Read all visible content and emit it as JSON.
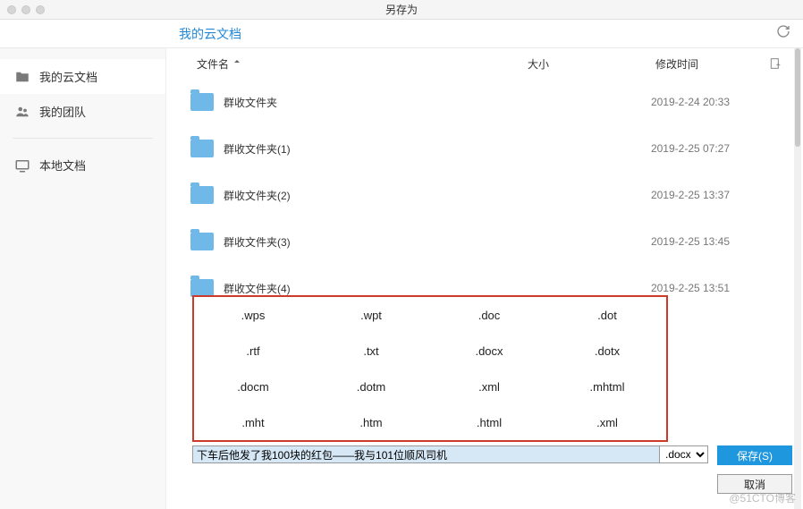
{
  "window": {
    "title": "另存为"
  },
  "toolbar": {
    "breadcrumb": "我的云文档"
  },
  "sidebar": {
    "items": [
      {
        "label": "我的云文档",
        "icon": "folder"
      },
      {
        "label": "我的团队",
        "icon": "team"
      },
      {
        "label": "本地文档",
        "icon": "device"
      }
    ]
  },
  "columns": {
    "name": "文件名",
    "size": "大小",
    "time": "修改时间"
  },
  "files": [
    {
      "name": "群收文件夹",
      "time": "2019-2-24 20:33"
    },
    {
      "name": "群收文件夹(1)",
      "time": "2019-2-25 07:27"
    },
    {
      "name": "群收文件夹(2)",
      "time": "2019-2-25 13:37"
    },
    {
      "name": "群收文件夹(3)",
      "time": "2019-2-25 13:45"
    },
    {
      "name": "群收文件夹(4)",
      "time": "2019-2-25 13:51"
    }
  ],
  "extensions": [
    ".wps",
    ".wpt",
    ".doc",
    ".dot",
    ".rtf",
    ".txt",
    ".docx",
    ".dotx",
    ".docm",
    ".dotm",
    ".xml",
    ".mhtml",
    ".mht",
    ".htm",
    ".html",
    ".xml"
  ],
  "filename": {
    "value": "下车后他发了我100块的红包——我与101位顺风司机",
    "ext": ".docx"
  },
  "buttons": {
    "save": "保存(S)",
    "cancel": "取消"
  },
  "watermark": "@51CTO博客"
}
